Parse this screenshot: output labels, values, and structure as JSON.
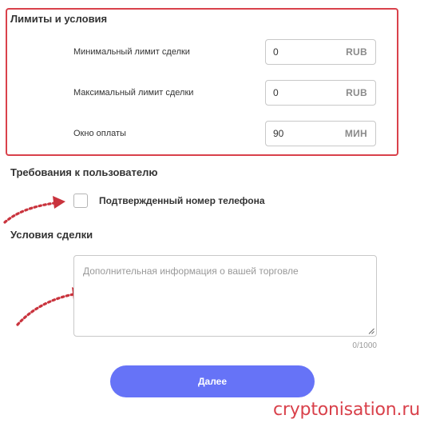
{
  "limits": {
    "title": "Лимиты и условия",
    "rows": [
      {
        "label": "Минимальный лимит сделки",
        "value": "0",
        "unit": "RUB"
      },
      {
        "label": "Максимальный лимит сделки",
        "value": "0",
        "unit": "RUB"
      },
      {
        "label": "Окно оплаты",
        "value": "90",
        "unit": "МИН"
      }
    ]
  },
  "requirements": {
    "title": "Требования к пользователю",
    "phone_checkbox_label": "Подтвержденный номер телефона",
    "phone_checked": false
  },
  "terms": {
    "title": "Условия сделки",
    "placeholder": "Дополнительная информация о вашей торговле",
    "counter": "0/1000"
  },
  "next_button_label": "Далее",
  "watermark": "cryptonisation.ru",
  "colors": {
    "highlight_border": "#d9414b",
    "button": "#6673f7",
    "arrow": "#c9333d"
  },
  "icons": {
    "annotation_arrow": "curved-dotted-arrow-icon",
    "resize_handle": "resize-handle-icon"
  }
}
